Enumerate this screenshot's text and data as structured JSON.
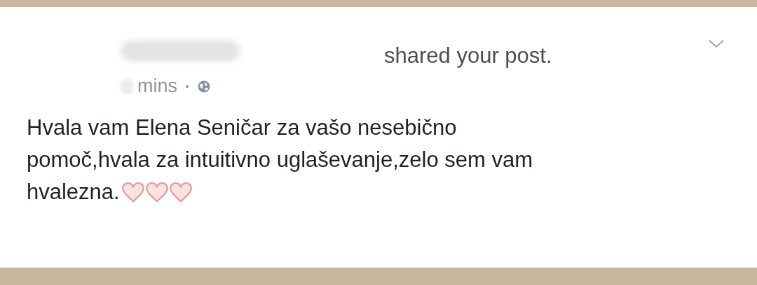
{
  "post": {
    "action": "shared your post.",
    "time": "mins",
    "body_lines": [
      "Hvala vam Elena Seničar za vašo nesebično",
      "pomoč,hvala za intuitivno uglaševanje,zelo sem vam",
      "hvalezna."
    ]
  }
}
